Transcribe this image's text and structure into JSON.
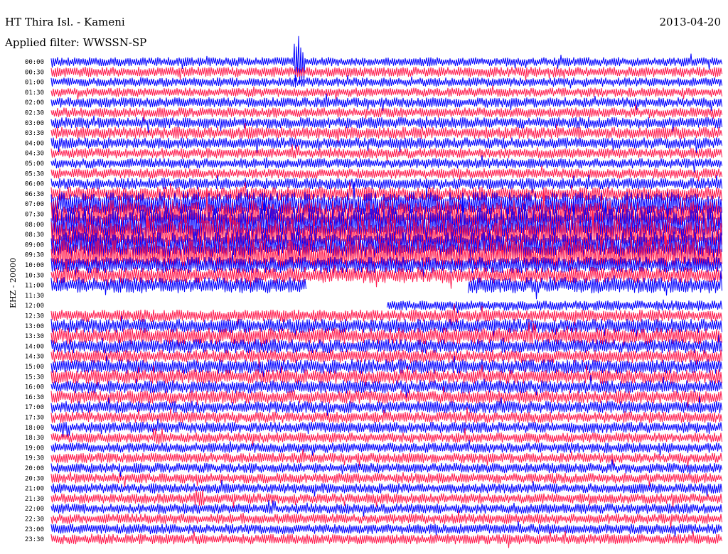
{
  "header": {
    "station": "HT Thira Isl. - Kameni",
    "filter": "Applied filter: WWSSN-SP",
    "date": "2013-04-20"
  },
  "colors": {
    "trace_a": "#0000ff",
    "trace_b": "#ff1a4d"
  },
  "chart_data": {
    "type": "line",
    "title": "",
    "ylabel": "EHZ - 20000",
    "xlabel": "",
    "rows": [
      "00:00",
      "00:30",
      "01:00",
      "01:30",
      "02:00",
      "02:30",
      "03:00",
      "03:30",
      "04:00",
      "04:30",
      "05:00",
      "05:30",
      "06:00",
      "06:30",
      "07:00",
      "07:30",
      "08:00",
      "08:30",
      "09:00",
      "09:30",
      "10:00",
      "10:30",
      "11:00",
      "11:30",
      "12:00",
      "12:30",
      "13:00",
      "13:30",
      "14:00",
      "14:30",
      "15:00",
      "15:30",
      "16:00",
      "16:30",
      "17:00",
      "17:30",
      "18:00",
      "18:30",
      "19:00",
      "19:30",
      "20:00",
      "20:30",
      "21:00",
      "21:30",
      "22:00",
      "22:30",
      "23:00",
      "23:30"
    ],
    "row_minutes": 30,
    "amplitude": [
      0.45,
      0.5,
      0.45,
      0.45,
      0.5,
      0.5,
      0.55,
      0.6,
      0.55,
      0.5,
      0.5,
      0.5,
      0.55,
      0.7,
      1.2,
      1.4,
      1.6,
      1.5,
      1.3,
      1.5,
      0.8,
      0.8,
      0.8,
      0.6,
      0.5,
      0.6,
      0.7,
      0.8,
      0.7,
      0.65,
      0.7,
      0.7,
      0.65,
      0.65,
      0.6,
      0.55,
      0.55,
      0.5,
      0.5,
      0.5,
      0.5,
      0.5,
      0.5,
      0.5,
      0.5,
      0.5,
      0.5,
      0.5
    ],
    "gaps": [
      [
        23,
        0.0,
        1.0
      ],
      [
        24,
        0.0,
        0.5
      ],
      [
        22,
        0.38,
        0.62
      ]
    ],
    "events": [
      [
        0,
        0.37,
        6.0
      ],
      [
        6,
        0.37,
        1.0
      ],
      [
        25,
        0.6,
        2.0
      ],
      [
        37,
        0.16,
        2.0
      ],
      [
        43,
        0.22,
        1.8
      ]
    ]
  }
}
